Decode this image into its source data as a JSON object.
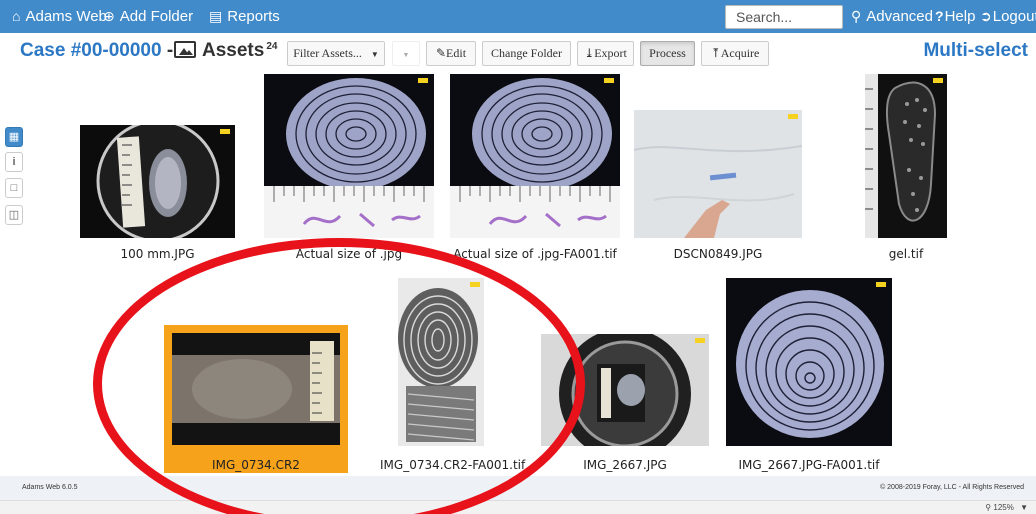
{
  "topnav": {
    "home_label": "Adams Web",
    "add_folder_label": "Add Folder",
    "reports_label": "Reports",
    "search_placeholder": "Search...",
    "advanced_label": "Advanced",
    "help_label": "Help",
    "logout_label": "Logout",
    "bar_color": "#428bca"
  },
  "header": {
    "case_title": "Case #00-00000",
    "separator": "-",
    "assets_title": "Assets",
    "assets_count": "24",
    "multi_select_label": "Multi-select"
  },
  "toolbar": {
    "filter_label": "Filter Assets...",
    "edit_label": "Edit",
    "change_folder_label": "Change Folder",
    "export_label": "Export",
    "process_label": "Process",
    "acquire_label": "Acquire"
  },
  "left_rail": [
    "grid-view-icon",
    "info-icon",
    "square-icon",
    "compare-icon"
  ],
  "assets": [
    {
      "name": "100 mm.JPG",
      "kind": "lens-ruler"
    },
    {
      "name": "Actual size of .jpg",
      "kind": "fingerprint-ruler"
    },
    {
      "name": "Actual size of .jpg-FA001.tif",
      "kind": "fingerprint-ruler"
    },
    {
      "name": "DSCN0849.JPG",
      "kind": "snow"
    },
    {
      "name": "gel.tif",
      "kind": "shoeprint"
    },
    {
      "name": "IMG_0734.CR2",
      "kind": "lift-ruler",
      "selected": true
    },
    {
      "name": "IMG_0734.CR2-FA001.tif",
      "kind": "fingerprint-gray"
    },
    {
      "name": "IMG_2667.JPG",
      "kind": "lens"
    },
    {
      "name": "IMG_2667.JPG-FA001.tif",
      "kind": "fingerprint"
    }
  ],
  "footer": {
    "version": "Adams Web 6.0.5",
    "copyright": "© 2008-2019 Foray, LLC - All Rights Reserved",
    "zoom": "125%"
  },
  "colors": {
    "accent": "#2c78c4",
    "selected": "#f7a21b",
    "annotation": "#e8121a"
  }
}
